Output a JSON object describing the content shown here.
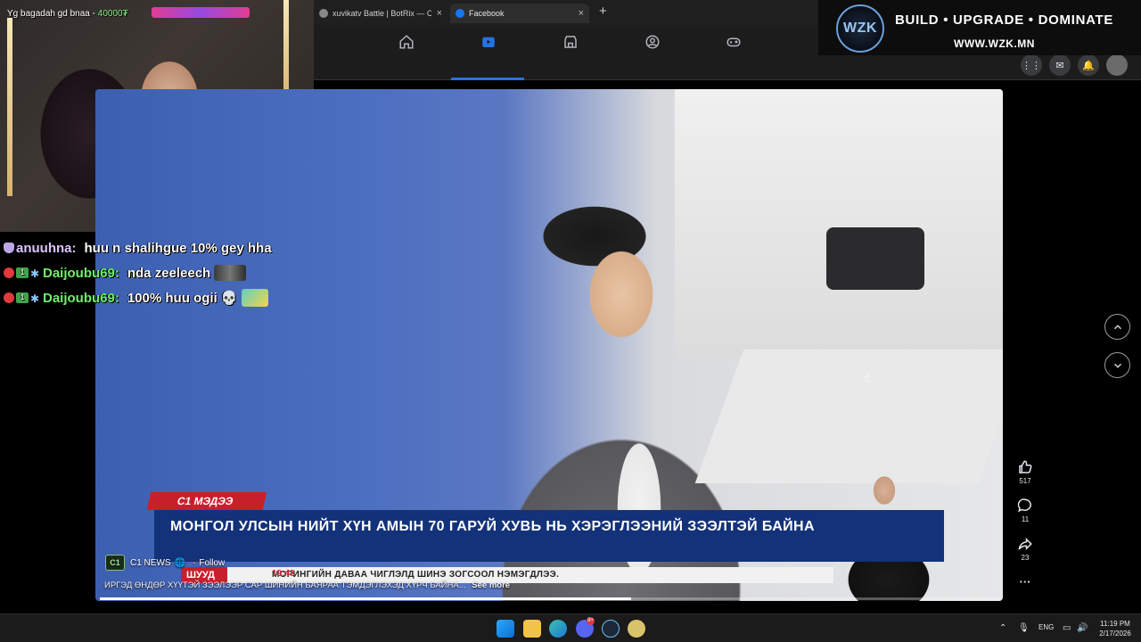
{
  "browser": {
    "tabs": [
      {
        "title": "xuvikatv Battle | BotRix — Cloud Stre",
        "icon_color": "#888888"
      },
      {
        "title": "Facebook",
        "icon_color": "#1877f2",
        "active": true
      }
    ],
    "new_tab_symbol": "+",
    "close_symbol": "×"
  },
  "facebook": {
    "nav_icons": [
      "home-icon",
      "video-icon",
      "marketplace-icon",
      "groups-icon",
      "gaming-icon"
    ],
    "active_nav": "video-icon",
    "right_buttons": [
      "menu-grid-icon",
      "messenger-icon",
      "notifications-icon",
      "account-avatar"
    ]
  },
  "sponsor": {
    "logo_text": "WZK",
    "slogan": "BUILD • UPGRADE • DOMINATE",
    "url": "WWW.WZK.MN"
  },
  "webcam": {
    "overlay_text": "Yg bagadah gd bnaa - ",
    "overlay_amount": "40000₮"
  },
  "chat": [
    {
      "user": "anuuhna:",
      "color": "#d8c5ff",
      "message": "huu n shalihgue 10% gey hha",
      "badges": [
        "shield"
      ]
    },
    {
      "user": "Daijoubu69:",
      "color": "#6ff068",
      "message": "nda zeeleech",
      "badges": [
        "heart",
        "sub",
        "snow"
      ],
      "emote": true
    },
    {
      "user": "Daijoubu69:",
      "color": "#6ff068",
      "message": "100% huu ogii 💀",
      "badges": [
        "heart",
        "sub",
        "snow"
      ],
      "emote": true
    }
  ],
  "video": {
    "lower_third": {
      "tag": "С1 МЭДЭЭ",
      "headline": "МОНГОЛ УЛСЫН НИЙТ ХҮН АМЫН 70 ГАРУЙ ХУВЬ НЬ ХЭРЭГЛЭЭНИЙ ЗЭЭЛТЭЙ БАЙНА",
      "live_label": "ШУУД",
      "ticker_time": "19:43",
      "ticker_text": "МОРИНГИЙН ДАВАА ЧИГЛЭЛД ШИНЭ ЗОГСООЛ НЭМЭГДЛЭЭ."
    },
    "page_logo": "C1",
    "page_name": "C1 NEWS",
    "follow_label": "Follow",
    "caption": "ИРГЭД ӨНДӨР ХҮҮТЭЙ ЗЭЭЛЭЭР САР ШИНИЙН БАЯРАА ТЭМДЭГЛЭХЭД ХҮРЧ БАЙНА...",
    "see_more": "See more",
    "progress_fraction": 0.59
  },
  "reactions": {
    "likes": "517",
    "comments": "11",
    "shares": "23",
    "more_symbol": "···"
  },
  "taskbar": {
    "tray_lang": "ENG",
    "time": "11:19 PM",
    "date": "2/17/2026",
    "discord_badge": "9+"
  }
}
